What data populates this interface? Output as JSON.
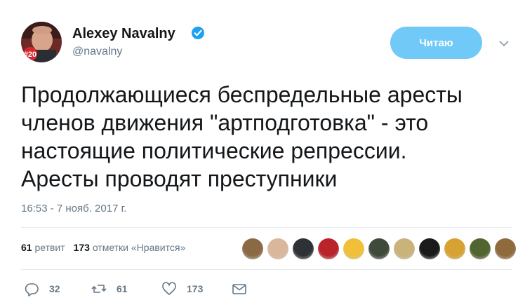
{
  "author": {
    "name": "Alexey Navalny",
    "handle": "@navalny",
    "avatar_badge": "#20"
  },
  "follow_button": {
    "label": "Читаю"
  },
  "tweet": {
    "text_lines": [
      "Продолжающиеся беспредельные аресты",
      "членов движения \"артподготовка\" - это",
      "настоящие политические репрессии.",
      "Аресты проводят преступники"
    ],
    "timestamp": "16:53 - 7 нояб. 2017 г."
  },
  "stats": {
    "retweets_count": "61",
    "retweets_label": "ретвит",
    "likes_count": "173",
    "likes_label": "отметки «Нравится»"
  },
  "liker_colors": [
    "#8a6a45",
    "#d9b79c",
    "#2e3236",
    "#b8242a",
    "#f0c03a",
    "#3f4a3a",
    "#c9b37a",
    "#1a1a1a",
    "#d8a233",
    "#50652f",
    "#8f6a3d"
  ],
  "actions": {
    "replies": "32",
    "retweets": "61",
    "likes": "173"
  },
  "colors": {
    "accent": "#1da1f2",
    "follow_bg": "#71c9f8",
    "muted": "#657786"
  }
}
